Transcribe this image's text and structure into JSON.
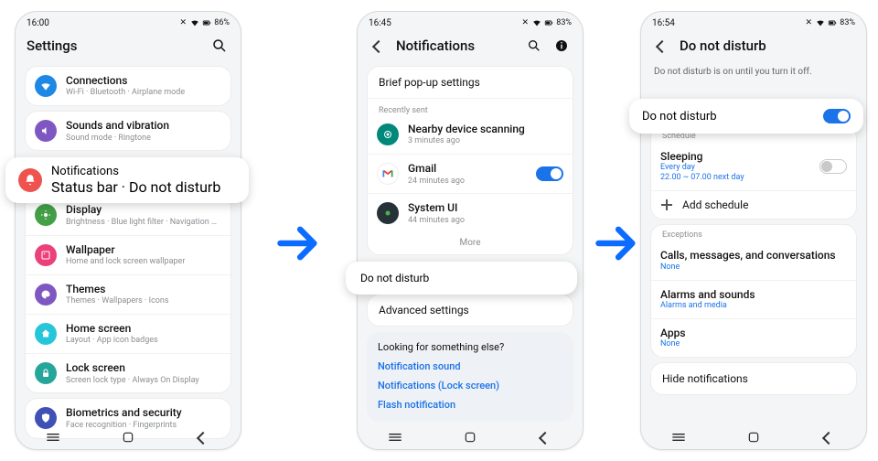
{
  "phone1": {
    "status": {
      "time": "16:00",
      "battery": "86%"
    },
    "header": {
      "title": "Settings"
    },
    "items": [
      {
        "id": "connections",
        "title": "Connections",
        "sub": "Wi-Fi · Bluetooth · Airplane mode",
        "color": "#1e88e5",
        "icon": "wifi"
      },
      {
        "id": "sounds",
        "title": "Sounds and vibration",
        "sub": "Sound mode · Ringtone",
        "color": "#7e57c2",
        "icon": "speaker"
      },
      {
        "id": "notifications",
        "title": "Notifications",
        "sub": "Status bar · Do not disturb",
        "color": "#ef5350",
        "icon": "bell"
      },
      {
        "id": "display",
        "title": "Display",
        "sub": "Brightness · Blue light filter · Navigation bar",
        "color": "#2e7d32",
        "icon": "sun"
      },
      {
        "id": "wallpaper",
        "title": "Wallpaper",
        "sub": "Home and lock screen wallpaper",
        "color": "#ec407a",
        "icon": "image"
      },
      {
        "id": "themes",
        "title": "Themes",
        "sub": "Themes · Wallpapers · Icons",
        "color": "#7e57c2",
        "icon": "palette"
      },
      {
        "id": "home",
        "title": "Home screen",
        "sub": "Layout · App icon badges",
        "color": "#26c6da",
        "icon": "home"
      },
      {
        "id": "lock",
        "title": "Lock screen",
        "sub": "Screen lock type · Always On Display",
        "color": "#26a69a",
        "icon": "lock"
      },
      {
        "id": "biometrics",
        "title": "Biometrics and security",
        "sub": "Face recognition · Fingerprints",
        "color": "#3f51b5",
        "icon": "shield"
      }
    ]
  },
  "phone2": {
    "status": {
      "time": "16:45",
      "battery": "83%"
    },
    "header": {
      "title": "Notifications"
    },
    "brief_row": "Brief pop-up settings",
    "recent_label": "Recently sent",
    "recent": [
      {
        "title": "Nearby device scanning",
        "sub": "3 minutes ago",
        "color": "#00897b",
        "toggle": null
      },
      {
        "title": "Gmail",
        "sub": "24 minutes ago",
        "color": "#ffffff",
        "toggle": "on"
      },
      {
        "title": "System UI",
        "sub": "44 minutes ago",
        "color": "#263238",
        "toggle": null
      }
    ],
    "more": "More",
    "dnd_row": "Do not disturb",
    "advanced_row": "Advanced settings",
    "looking": {
      "title": "Looking for something else?",
      "links": [
        "Notification sound",
        "Notifications (Lock screen)",
        "Flash notification"
      ]
    }
  },
  "phone3": {
    "status": {
      "time": "16:54",
      "battery": "83%"
    },
    "header": {
      "title": "Do not disturb"
    },
    "info": "Do not disturb is on until you turn it off.",
    "dnd": {
      "label": "Do not disturb",
      "on": true
    },
    "schedule_label": "Schedule",
    "schedule": {
      "title": "Sleeping",
      "sub1": "Every day",
      "sub2": "22.00 ~ 07.00 next day"
    },
    "add_schedule": "Add schedule",
    "exceptions_label": "Exceptions",
    "exceptions": [
      {
        "title": "Calls, messages, and conversations",
        "sub": "None"
      },
      {
        "title": "Alarms and sounds",
        "sub": "Alarms and media"
      },
      {
        "title": "Apps",
        "sub": "None"
      }
    ],
    "hide": "Hide notifications"
  }
}
